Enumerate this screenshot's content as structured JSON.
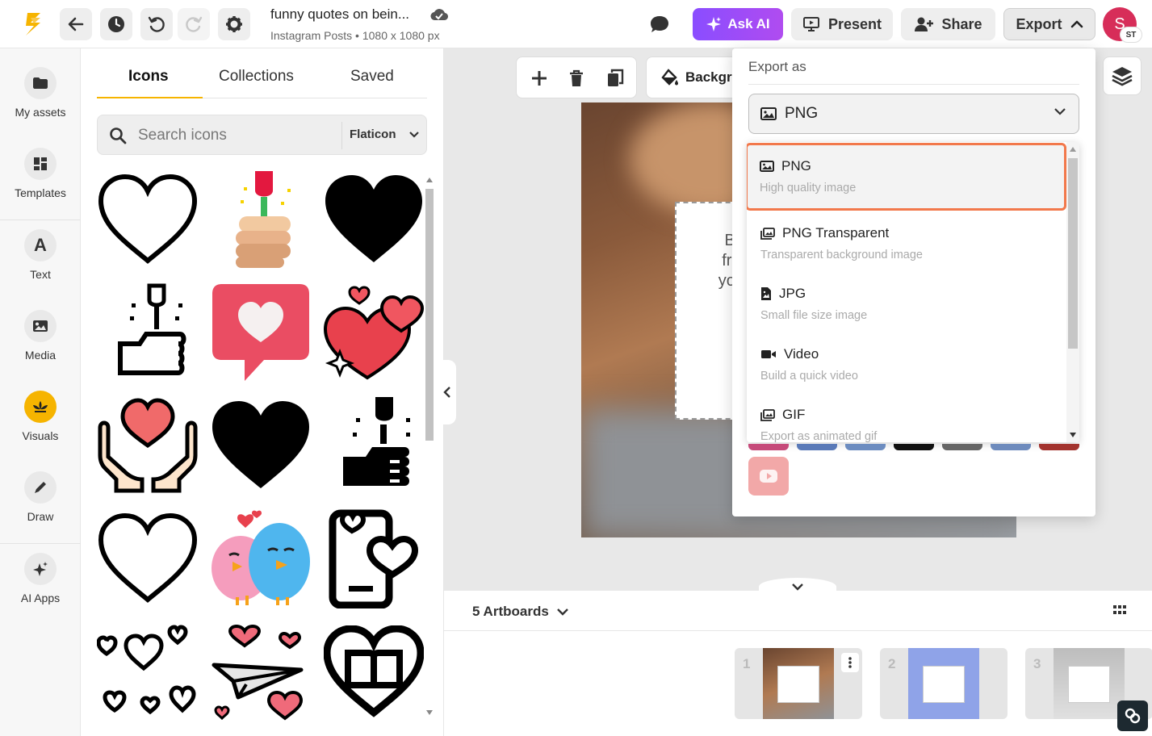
{
  "topbar": {
    "doc_title": "funny quotes on bein...",
    "doc_subtitle": "Instagram Posts • 1080 x 1080 px",
    "ask_ai_label": "Ask AI",
    "present_label": "Present",
    "share_label": "Share",
    "export_label": "Export",
    "avatar_initial": "S",
    "avatar_badge": "ST",
    "brand_color": "#f6b400",
    "ask_ai_color": "#8a4dff"
  },
  "rail": {
    "items": [
      {
        "label": "My assets",
        "icon": "folder-icon"
      },
      {
        "label": "Templates",
        "icon": "templates-icon"
      },
      {
        "label": "Text",
        "icon": "text-icon"
      },
      {
        "label": "Media",
        "icon": "image-icon"
      },
      {
        "label": "Visuals",
        "icon": "visuals-icon"
      },
      {
        "label": "Draw",
        "icon": "pen-icon"
      },
      {
        "label": "AI Apps",
        "icon": "sparkle-icon"
      }
    ]
  },
  "panel": {
    "tabs": [
      "Icons",
      "Collections",
      "Saved"
    ],
    "active_tab": "Icons",
    "search_placeholder": "Search icons",
    "provider": "Flaticon",
    "icons": [
      "heart-outline-icon",
      "hand-rose-icon",
      "heart-solid-icon",
      "hand-flower-icon",
      "heart-speech-bubble-icon",
      "hearts-sparkle-icon",
      "hands-heart-icon",
      "heart-solid-icon",
      "hand-flower-solid-icon",
      "heart-outline-icon",
      "love-birds-icon",
      "phone-heart-icon",
      "small-hearts-icon",
      "paper-plane-hearts-icon",
      "heart-book-icon"
    ]
  },
  "canvas": {
    "background_label": "Backgr",
    "speech_text": [
      "Be",
      "frie",
      "you"
    ]
  },
  "bottom": {
    "artboards_label": "5 Artboards",
    "thumbnails": [
      "1",
      "2",
      "3"
    ]
  },
  "export_menu": {
    "title": "Export as",
    "selected_format": "PNG",
    "options": [
      {
        "name": "PNG",
        "description": "High quality image",
        "icon": "image-icon"
      },
      {
        "name": "PNG Transparent",
        "description": "Transparent background image",
        "icon": "images-icon"
      },
      {
        "name": "JPG",
        "description": "Small file size image",
        "icon": "file-image-icon"
      },
      {
        "name": "Video",
        "description": "Build a quick video",
        "icon": "video-icon"
      },
      {
        "name": "GIF",
        "description": "Export as animated gif",
        "icon": "gif-icon"
      }
    ],
    "highlight_color": "#f2784b"
  }
}
